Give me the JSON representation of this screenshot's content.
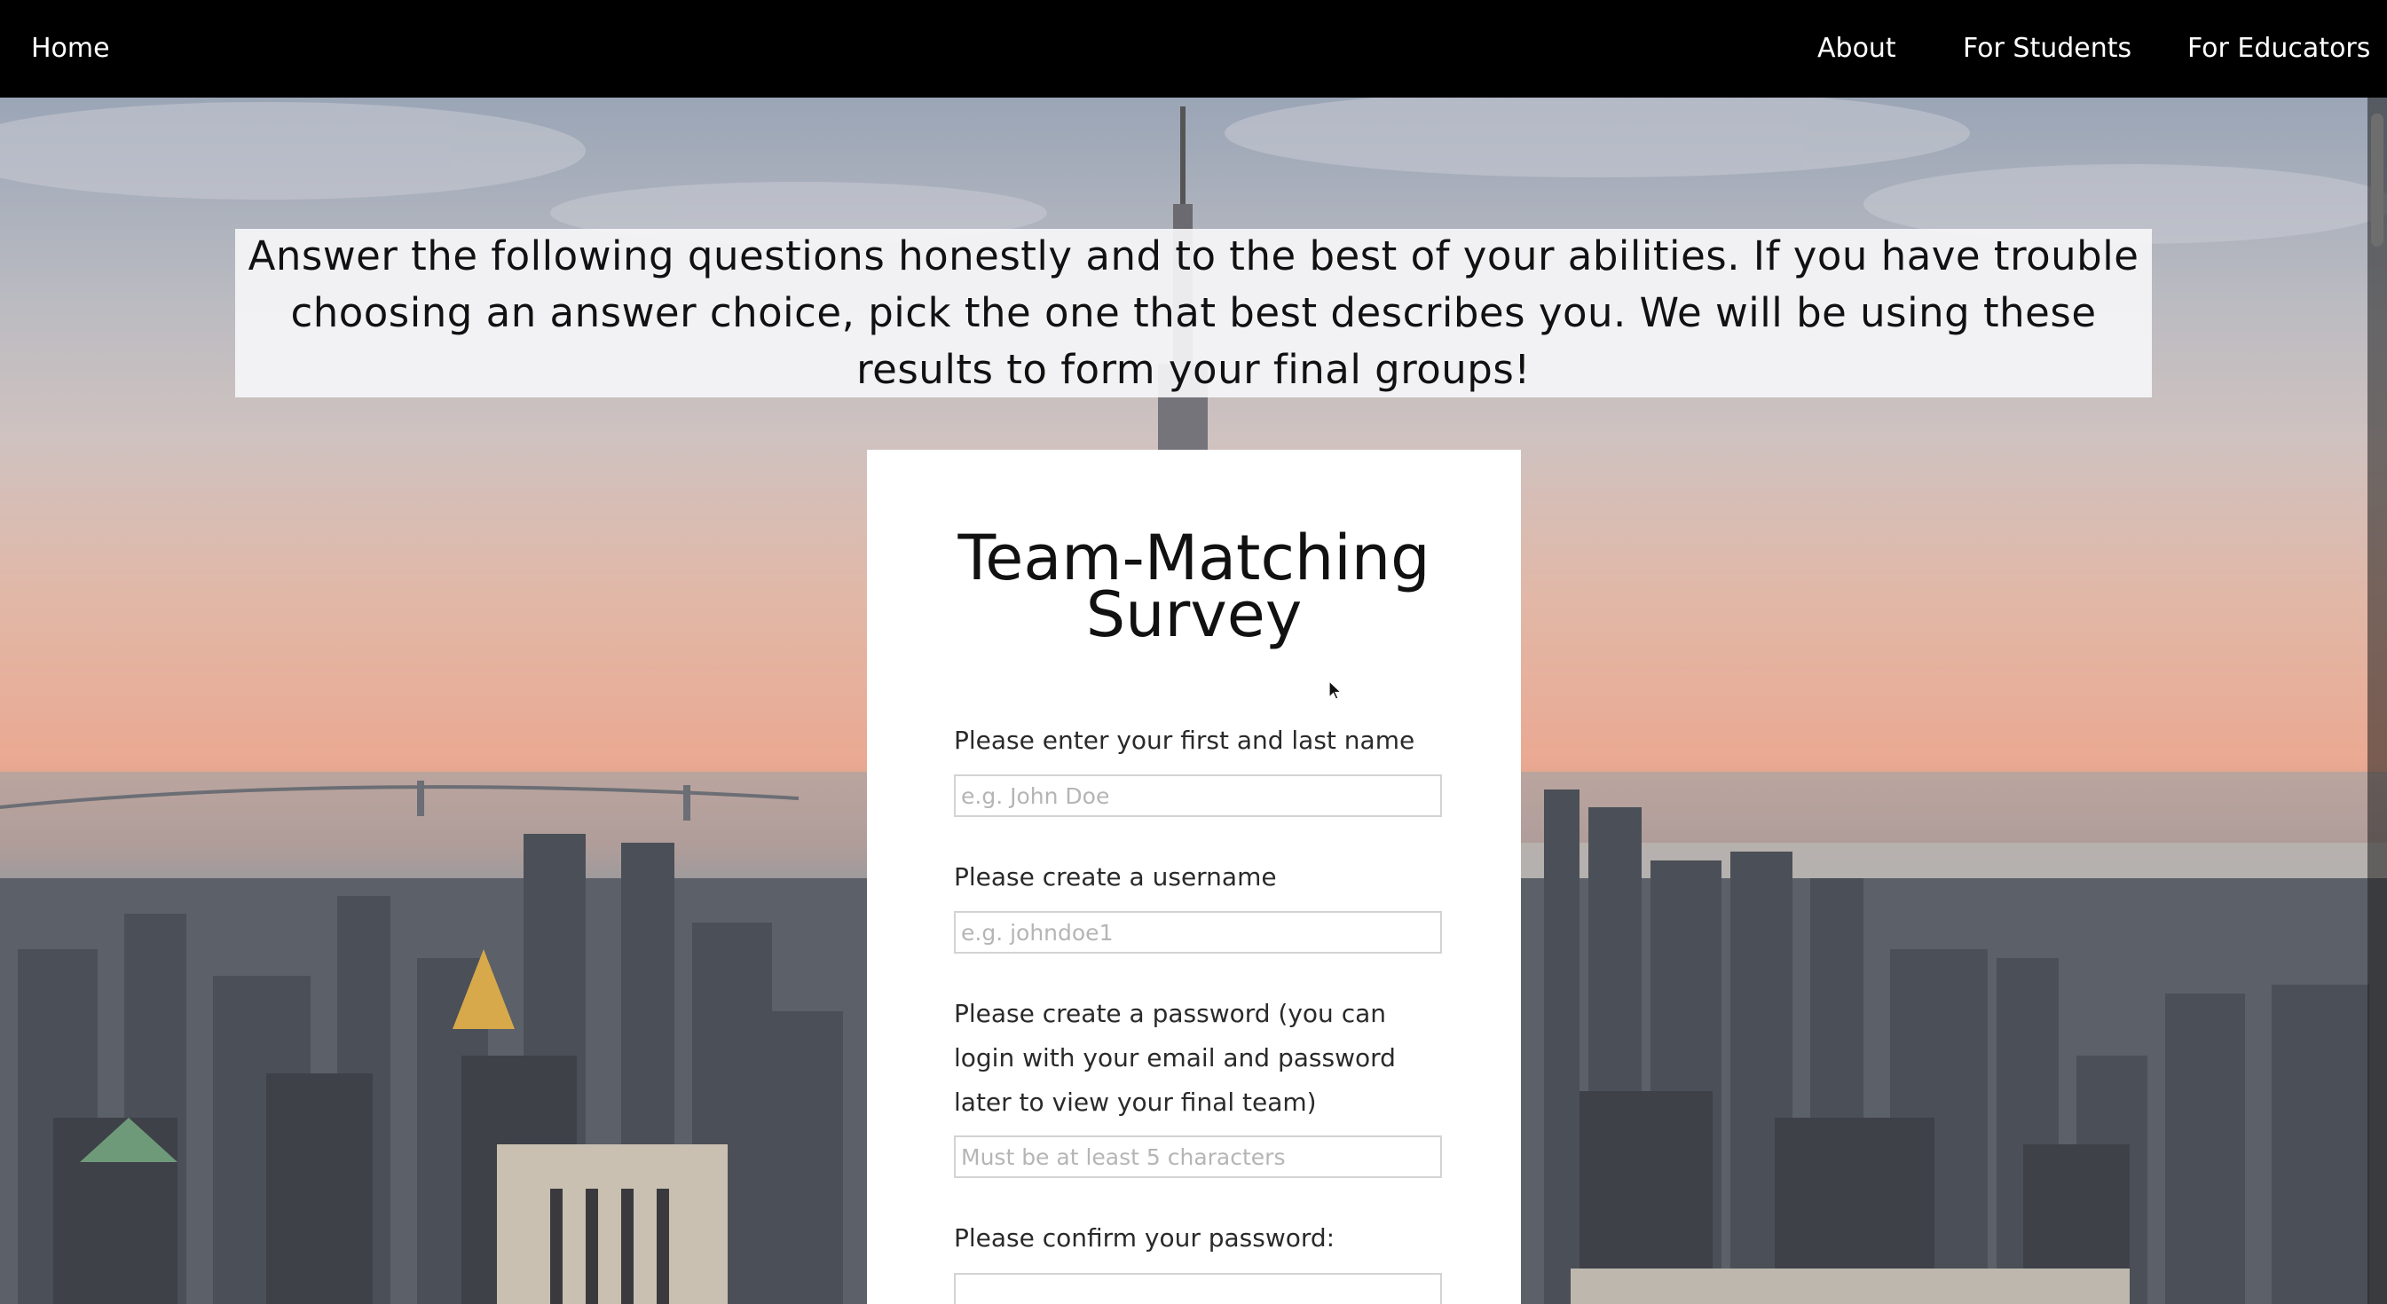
{
  "nav": {
    "home": "Home",
    "about": "About",
    "students": "For Students",
    "educators": "For Educators"
  },
  "intro": {
    "text": "Answer the following questions honestly and to the best of your abilities. If you have trouble choosing an answer choice, pick the one that best describes you. We will be using these results to form your final groups!"
  },
  "form": {
    "title": "Team-Matching Survey",
    "fields": [
      {
        "label": "Please enter your first and last name",
        "placeholder": "e.g. John Doe",
        "value": ""
      },
      {
        "label": "Please create a username",
        "placeholder": "e.g. johndoe1",
        "value": ""
      },
      {
        "label": "Please create a password (you can login with your email and password later to view your final team)",
        "placeholder": "Must be at least 5 characters",
        "value": ""
      },
      {
        "label": "Please confirm your password:",
        "placeholder": "",
        "value": ""
      }
    ]
  },
  "colors": {
    "navbar": "#000000",
    "card": "#ffffff",
    "banner": "#f5f5f7"
  }
}
